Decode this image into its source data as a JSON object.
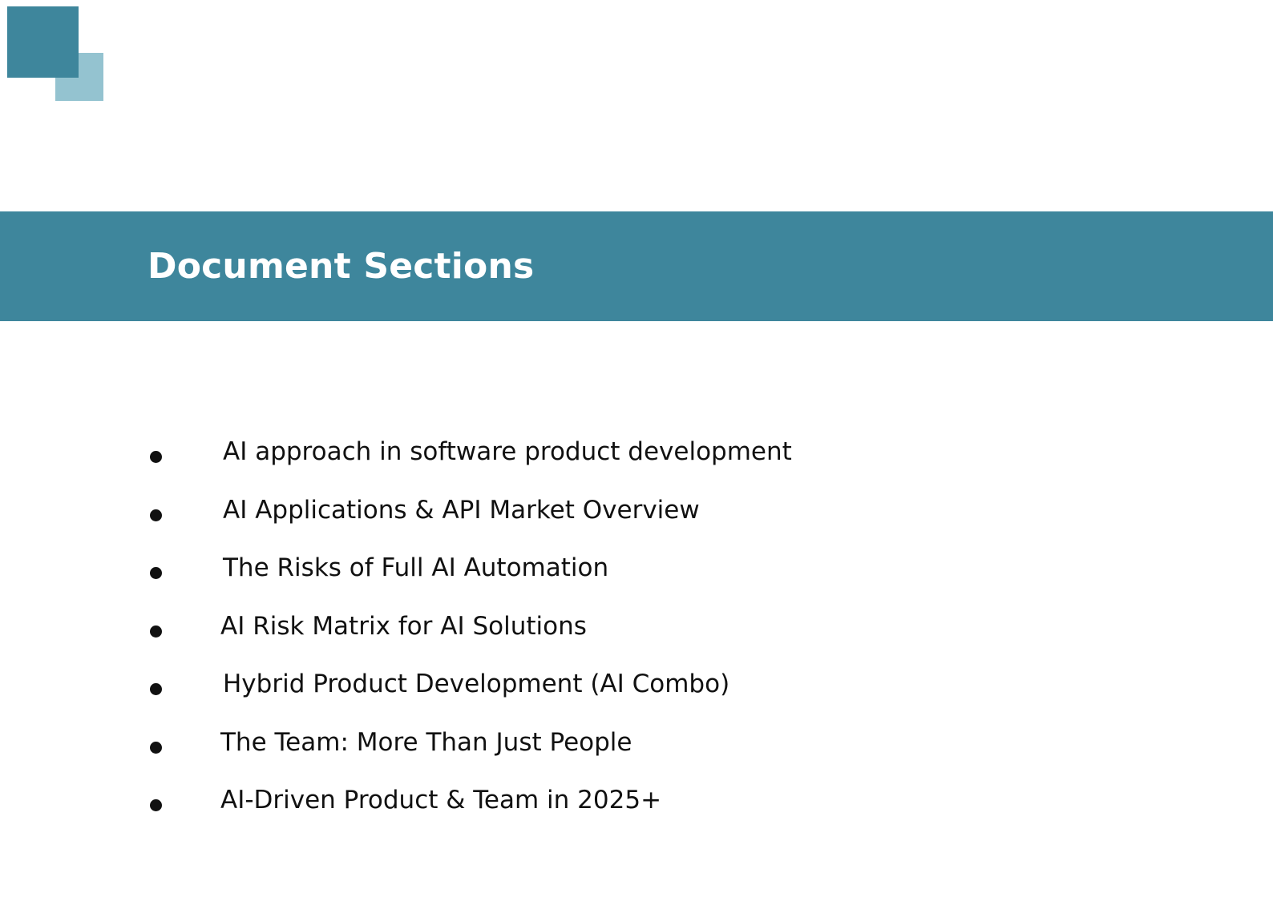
{
  "header": {
    "title": "Document Sections"
  },
  "colors": {
    "brand": "#3e869c",
    "brand_light": "#94c3d0"
  },
  "sections": [
    {
      "label": "AI approach in software product development"
    },
    {
      "label": "AI Applications & API Market Overview"
    },
    {
      "label": "The Risks of Full AI Automation"
    },
    {
      "label": "AI Risk Matrix for AI Solutions"
    },
    {
      "label": "Hybrid Product Development (AI Combo)"
    },
    {
      "label": "The Team: More Than Just People"
    },
    {
      "label": "AI-Driven Product & Team in 2025+"
    }
  ]
}
